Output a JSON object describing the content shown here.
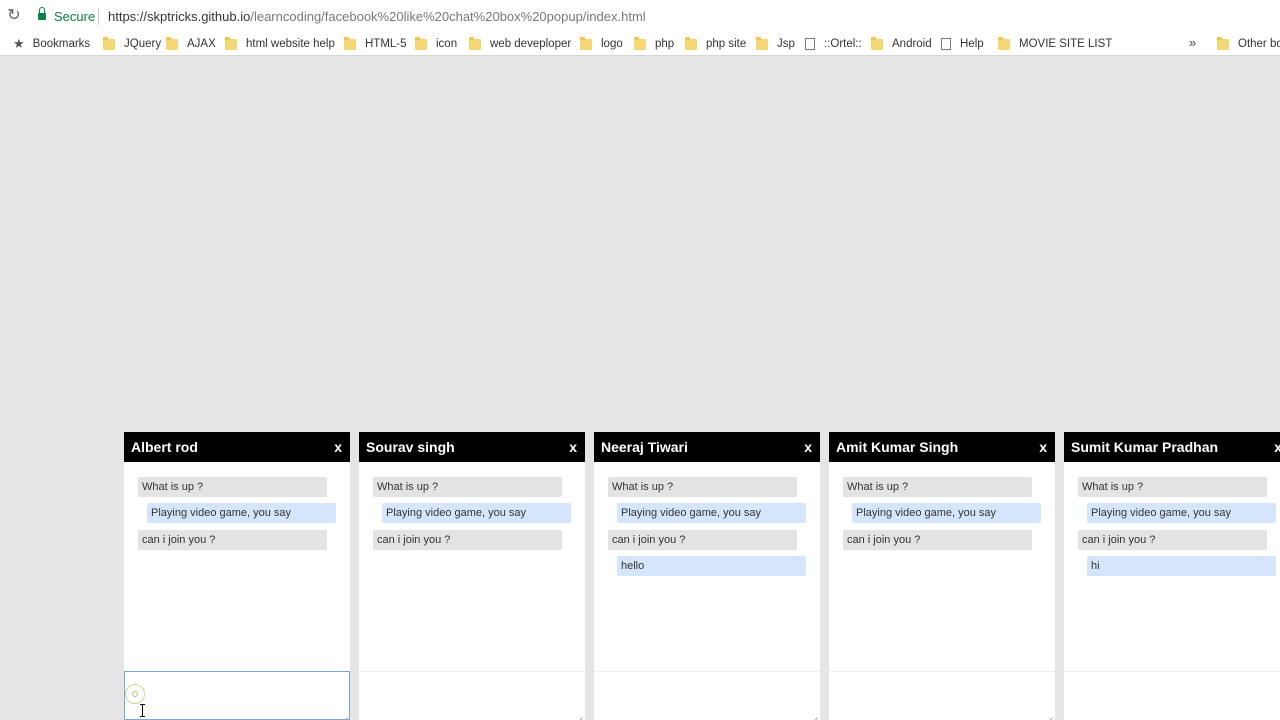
{
  "browser": {
    "secure_label": "Secure",
    "url_host": "https://skptricks.github.io",
    "url_path": "/learncoding/facebook%20like%20chat%20box%20popup/index.html",
    "bookmarks": [
      {
        "label": "Bookmarks",
        "icon": "star-icon"
      },
      {
        "label": "JQuery",
        "icon": "folder-icon"
      },
      {
        "label": "AJAX",
        "icon": "folder-icon"
      },
      {
        "label": "html website help",
        "icon": "folder-icon"
      },
      {
        "label": "HTML-5",
        "icon": "folder-icon"
      },
      {
        "label": "icon",
        "icon": "folder-icon"
      },
      {
        "label": "web deveploper",
        "icon": "folder-icon"
      },
      {
        "label": "logo",
        "icon": "folder-icon"
      },
      {
        "label": "php",
        "icon": "folder-icon"
      },
      {
        "label": "php site",
        "icon": "folder-icon"
      },
      {
        "label": "Jsp",
        "icon": "folder-icon"
      },
      {
        "label": "::Ortel::",
        "icon": "page-icon"
      },
      {
        "label": "Android",
        "icon": "folder-icon"
      },
      {
        "label": "Help",
        "icon": "page-icon"
      },
      {
        "label": "MOVIE SITE LIST",
        "icon": "folder-icon"
      }
    ],
    "overflow_label": "»",
    "other_bookmarks": "Other bookmarks"
  },
  "chats": [
    {
      "name": "Albert rod",
      "close": "x",
      "messages": [
        {
          "text": "What is up ?",
          "dir": "in"
        },
        {
          "text": "Playing video game, you say",
          "dir": "out"
        },
        {
          "text": "can i join you ?",
          "dir": "in"
        }
      ]
    },
    {
      "name": "Sourav singh",
      "close": "x",
      "messages": [
        {
          "text": "What is up ?",
          "dir": "in"
        },
        {
          "text": "Playing video game, you say",
          "dir": "out"
        },
        {
          "text": "can i join you ?",
          "dir": "in"
        }
      ]
    },
    {
      "name": "Neeraj Tiwari",
      "close": "x",
      "messages": [
        {
          "text": "What is up ?",
          "dir": "in"
        },
        {
          "text": "Playing video game, you say",
          "dir": "out"
        },
        {
          "text": "can i join you ?",
          "dir": "in"
        },
        {
          "text": "hello",
          "dir": "out"
        }
      ]
    },
    {
      "name": "Amit Kumar Singh",
      "close": "x",
      "messages": [
        {
          "text": "What is up ?",
          "dir": "in"
        },
        {
          "text": "Playing video game, you say",
          "dir": "out"
        },
        {
          "text": "can i join you ?",
          "dir": "in"
        }
      ]
    },
    {
      "name": "Sumit Kumar Pradhan",
      "close": "x",
      "messages": [
        {
          "text": "What is up ?",
          "dir": "in"
        },
        {
          "text": "Playing video game, you say",
          "dir": "out"
        },
        {
          "text": "can i join you ?",
          "dir": "in"
        },
        {
          "text": "hi",
          "dir": "out"
        }
      ]
    }
  ]
}
